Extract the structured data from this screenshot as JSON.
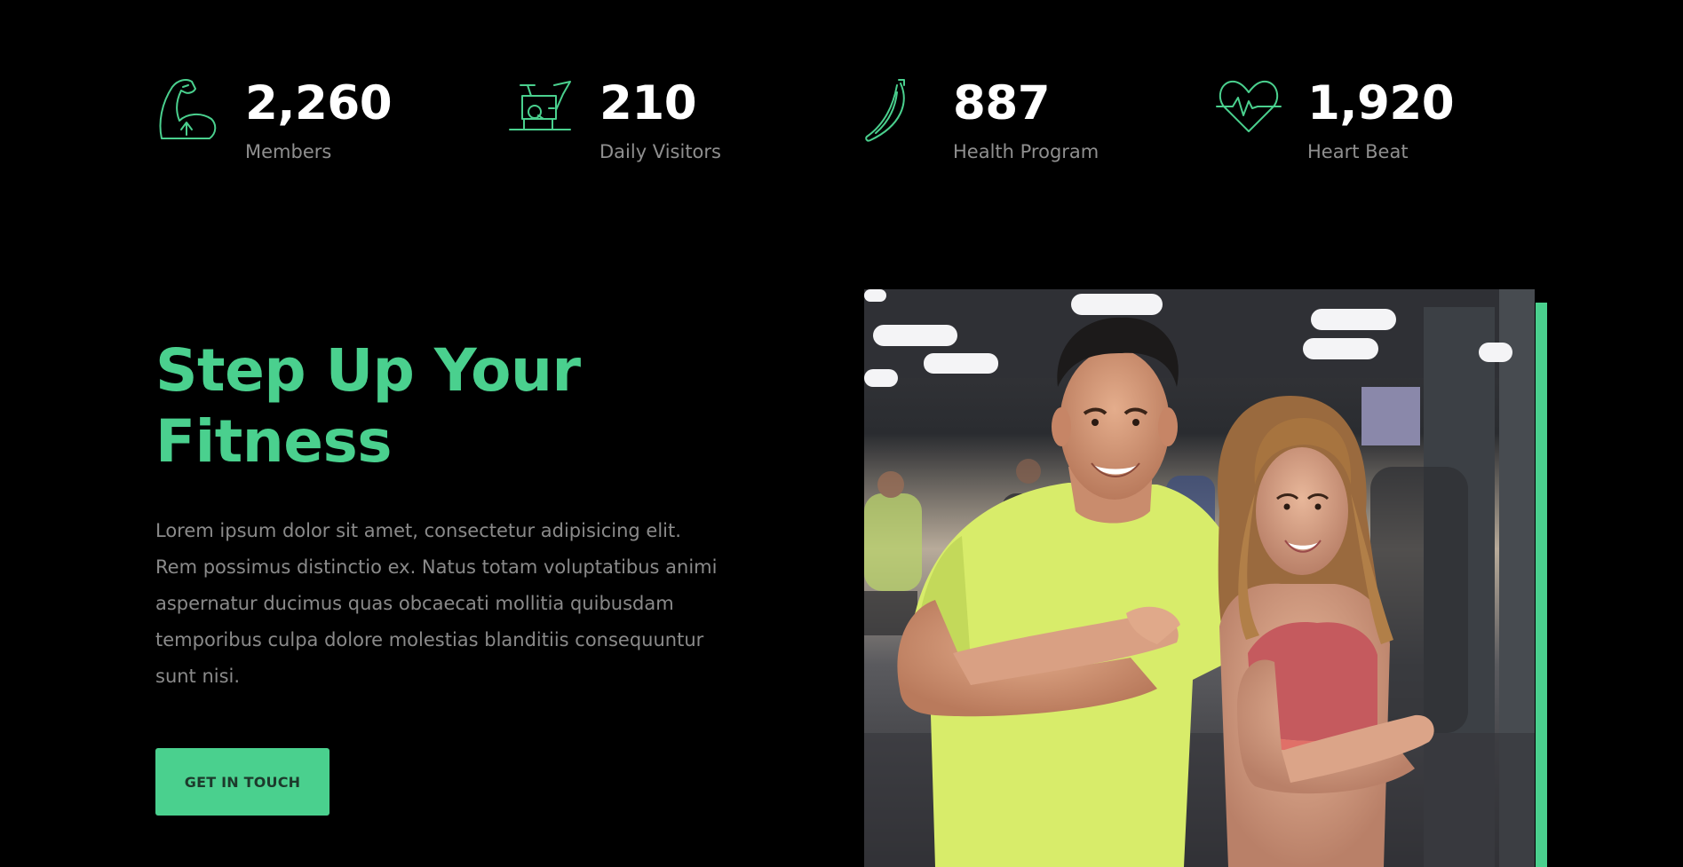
{
  "colors": {
    "accent": "#4ad08e",
    "background": "#000000",
    "number": "#ffffff",
    "label": "#8f8f8f",
    "body_text": "#8a8a8a",
    "button_text": "#1d3a2c"
  },
  "stats": [
    {
      "icon": "flexed-arm-icon",
      "value": "2,260",
      "label": "Members"
    },
    {
      "icon": "exercise-bike-icon",
      "value": "210",
      "label": "Daily Visitors"
    },
    {
      "icon": "banana-icon",
      "value": "887",
      "label": "Health Program"
    },
    {
      "icon": "heartbeat-icon",
      "value": "1,920",
      "label": "Heart Beat"
    }
  ],
  "hero": {
    "title_line1": "Step Up Your",
    "title_line2": "Fitness",
    "body": "Lorem ipsum dolor sit amet, consectetur adipisicing elit. Rem possimus distinctio ex. Natus totam voluptatibus animi aspernatur ducimus quas obcaecati mollitia quibusdam temporibus culpa dolore molestias blanditiis consequuntur sunt nisi.",
    "cta_label": "GET IN TOUCH"
  },
  "photo": {
    "subject": "man-and-woman-in-gym-photo"
  }
}
